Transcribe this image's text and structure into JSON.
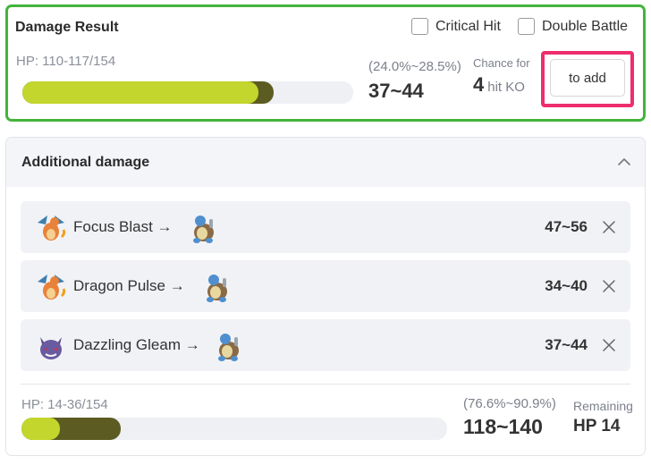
{
  "result": {
    "title": "Damage Result",
    "critical_hit_label": "Critical Hit",
    "double_battle_label": "Double Battle",
    "hp_text": "HP: 110-117/154",
    "hp_remaining_min_fraction": 0.714,
    "hp_remaining_max_fraction": 0.76,
    "percent_text": "(24.0%~28.5%)",
    "damage_text": "37~44",
    "chance_label": "Chance for",
    "hits_number": "4",
    "hits_suffix": "hit KO",
    "add_button_label": "to add",
    "colors": {
      "border": "#43b43a",
      "highlight": "#ee2d6e",
      "bar_light": "#c2d62d",
      "bar_dark": "#5c5c22"
    }
  },
  "additional": {
    "title": "Additional damage",
    "collapse_icon": "chevron-up-icon",
    "moves": [
      {
        "attacker_icon": "charizard-sprite-icon",
        "name": "Focus Blast",
        "arrow": "→",
        "target_icon": "blastoise-sprite-icon",
        "damage": "47~56",
        "remove_icon": "close-icon"
      },
      {
        "attacker_icon": "charizard-sprite-icon",
        "name": "Dragon Pulse",
        "arrow": "→",
        "target_icon": "blastoise-sprite-icon",
        "damage": "34~40",
        "remove_icon": "close-icon"
      },
      {
        "attacker_icon": "gengar-sprite-icon",
        "name": "Dazzling Gleam",
        "arrow": "→",
        "target_icon": "blastoise-sprite-icon",
        "damage": "37~44",
        "remove_icon": "close-icon"
      }
    ],
    "total": {
      "hp_text": "HP: 14-36/154",
      "hp_remaining_min_fraction": 0.091,
      "hp_remaining_max_fraction": 0.234,
      "percent_text": "(76.6%~90.9%)",
      "damage_text": "118~140",
      "remaining_label": "Remaining",
      "remaining_value": "HP 14"
    }
  }
}
